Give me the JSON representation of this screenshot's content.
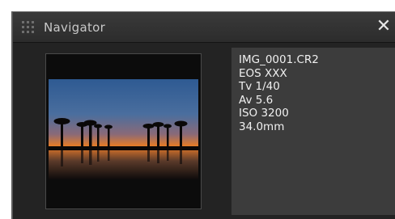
{
  "panel": {
    "title": "Navigator",
    "close_glyph": "✕"
  },
  "info": {
    "lines": [
      "IMG_0001.CR2",
      "EOS XXX",
      "Tv 1/40",
      "Av 5.6",
      "ISO 3200",
      "34.0mm"
    ]
  }
}
